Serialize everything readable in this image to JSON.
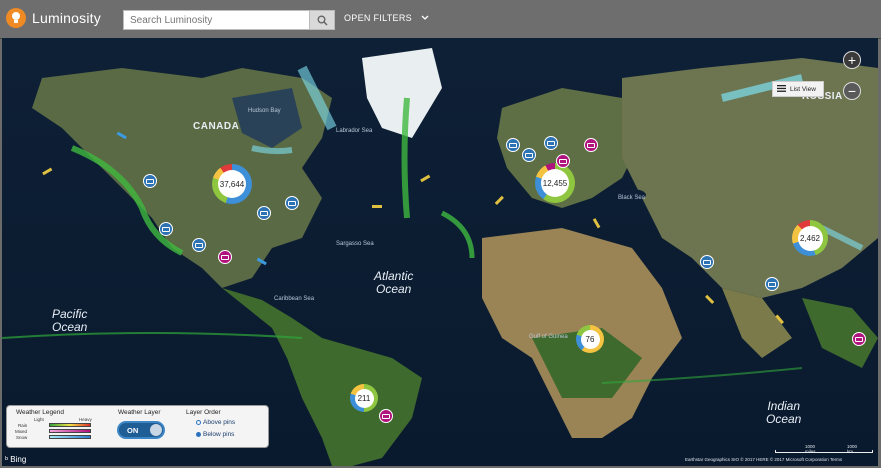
{
  "header": {
    "app_title": "Luminosity",
    "search_placeholder": "Search Luminosity",
    "filters_label": "OPEN FILTERS"
  },
  "map": {
    "list_view_label": "List View",
    "zoom_in_label": "+",
    "zoom_out_label": "−",
    "countries": {
      "canada": "CANADA",
      "russia": "RUSSIA"
    },
    "oceans": {
      "atlantic": [
        "Atlantic",
        "Ocean"
      ],
      "pacific": [
        "Pacific",
        "Ocean"
      ],
      "indian": [
        "Indian",
        "Ocean"
      ]
    },
    "seas": {
      "hudson_bay": "Hudson Bay",
      "labrador_sea": "Labrador Sea",
      "sargasso_sea": "Sargasso Sea",
      "caribbean_sea": "Caribbean Sea",
      "black_sea": "Black Sea",
      "gulf_of_guinea": "Gulf of Guinea"
    },
    "clusters": [
      {
        "id": "north-america",
        "count": "37,644"
      },
      {
        "id": "europe",
        "count": "12,455"
      },
      {
        "id": "asia",
        "count": "2,462"
      },
      {
        "id": "africa",
        "count": "76"
      },
      {
        "id": "south-america",
        "count": "211"
      }
    ],
    "attribution": {
      "bing": "Bing",
      "copyright": "Earthstar Geographics SIO © 2017 HERE © 2017 Microsoft Corporation Terms",
      "scale_miles": "1000 miles",
      "scale_km": "1000 km"
    }
  },
  "legend": {
    "weather_legend_title": "Weather Legend",
    "light": "Light",
    "heavy": "Heavy",
    "rows": [
      "Rain",
      "Mixed",
      "Snow"
    ],
    "weather_layer_title": "Weather Layer",
    "toggle_label": "ON",
    "layer_order_title": "Layer Order",
    "options": [
      "Above pins",
      "Below pins"
    ],
    "selected_option": "Below pins"
  },
  "colors": {
    "accent_orange": "#f08a24",
    "pin_blue": "#2d73b4",
    "pin_magenta": "#b0127e",
    "toggle_blue": "#1f5d95"
  }
}
